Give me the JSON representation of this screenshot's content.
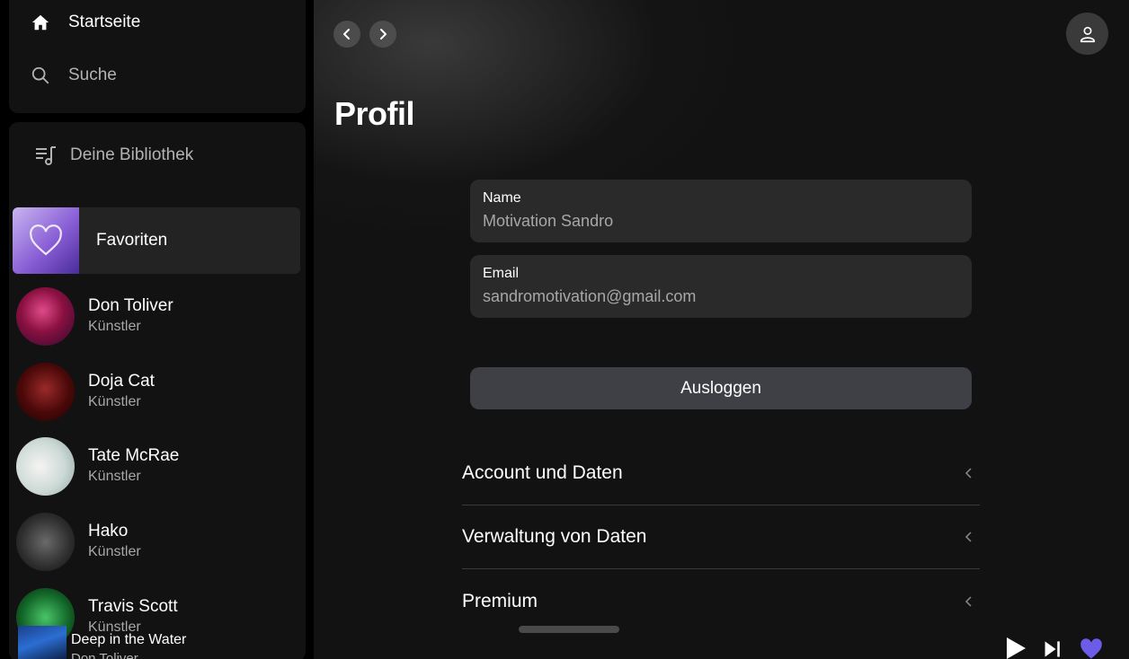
{
  "sidebar": {
    "nav": {
      "home_label": "Startseite",
      "search_label": "Suche"
    },
    "library": {
      "title": "Deine Bibliothek",
      "favorites_label": "Favoriten",
      "items": [
        {
          "name": "Don Toliver",
          "type": "Künstler",
          "color": "#b8206a"
        },
        {
          "name": "Doja Cat",
          "type": "Künstler",
          "color": "#7a1010"
        },
        {
          "name": "Tate McRae",
          "type": "Künstler",
          "color": "#cfd8d4"
        },
        {
          "name": "Hako",
          "type": "Künstler",
          "color": "#3a3a3a"
        },
        {
          "name": "Travis Scott",
          "type": "Künstler",
          "color": "#1e6b2a"
        }
      ]
    }
  },
  "main": {
    "title": "Profil",
    "fields": {
      "name_label": "Name",
      "name_value": "Motivation Sandro",
      "email_label": "Email",
      "email_value": "sandromotivation@gmail.com"
    },
    "logout_label": "Ausloggen",
    "menu": [
      {
        "label": "Account und Daten"
      },
      {
        "label": "Verwaltung von Daten"
      },
      {
        "label": "Premium"
      }
    ]
  },
  "player": {
    "track_title": "Deep in the Water",
    "track_artist": "Don Toliver",
    "accent_color": "#6c5ce7"
  },
  "icons": [
    "home-icon",
    "search-icon",
    "library-icon",
    "heart-icon",
    "chevron-left-icon",
    "chevron-right-icon",
    "user-icon",
    "play-icon",
    "skip-next-icon"
  ]
}
